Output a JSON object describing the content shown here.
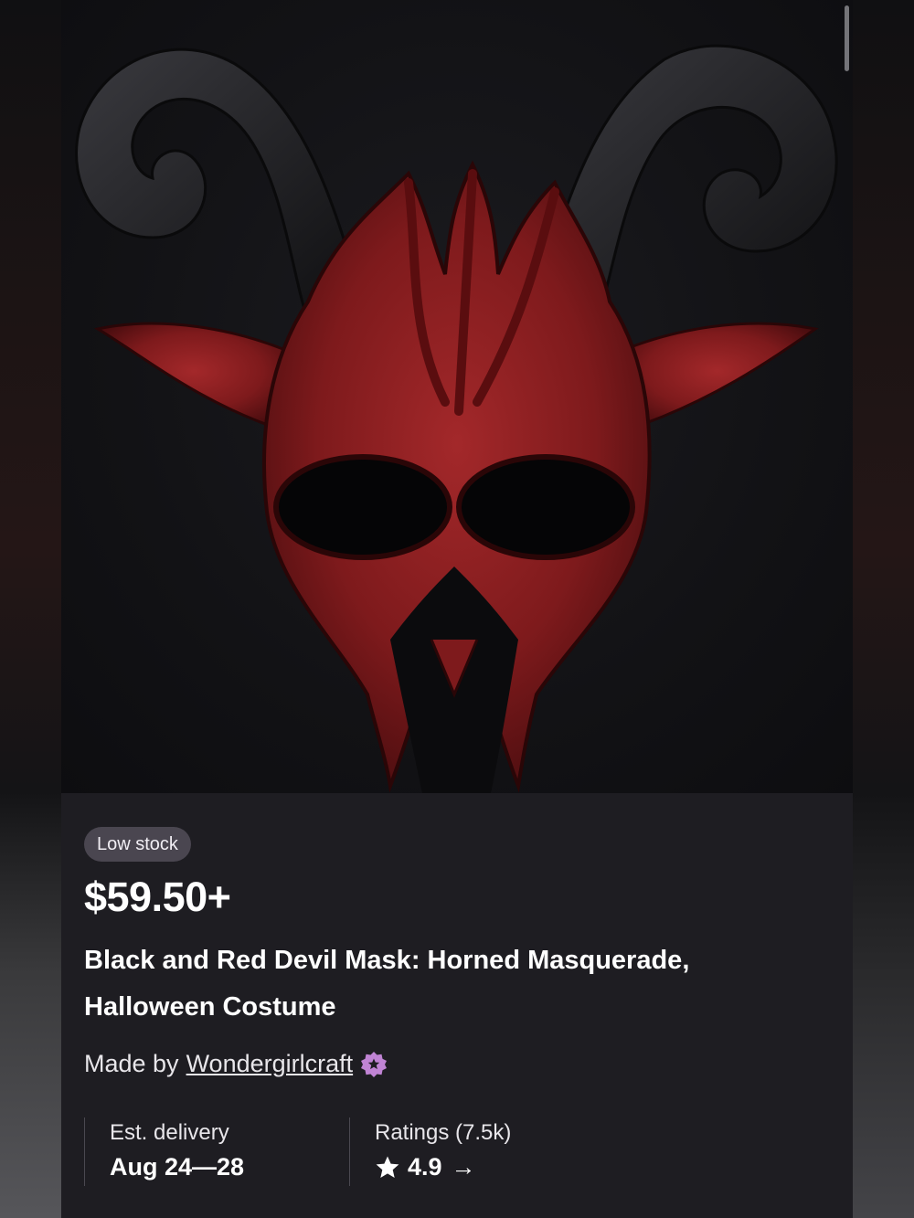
{
  "product": {
    "stock_badge": "Low stock",
    "price": "$59.50+",
    "title": "Black and Red Devil Mask: Horned Masquerade, Halloween Costume",
    "maker_prefix": "Made by",
    "shop_name": "Wondergirlcraft",
    "star_seller_icon": "star-seller-badge-icon",
    "image_icon": "devil-mask-photo"
  },
  "delivery": {
    "label": "Est. delivery",
    "value": "Aug 24—28"
  },
  "ratings": {
    "label": "Ratings (7.5k)",
    "value": "4.9",
    "arrow": "→"
  },
  "colors": {
    "sheet_background": "#1e1d22",
    "badge_background": "#4a4650",
    "star_seller_badge": "#c084d4",
    "mask_red": "#8e1d1f",
    "horn_black": "#1c1c1f"
  }
}
